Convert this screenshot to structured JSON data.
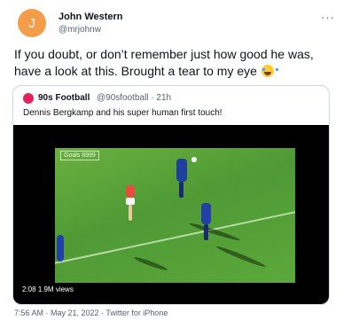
{
  "author": {
    "avatar_letter": "J",
    "name": "John Western",
    "handle": "@mrjohnw",
    "avatar_color": "#f39c4a"
  },
  "more_icon": "ellipsis-icon",
  "tweet": {
    "text": "If you doubt, or don’t remember just how good he was, have a look at this.   Brought a tear to my eye",
    "emoji": "face-with-tears-of-joy"
  },
  "quoted": {
    "name": "90s Football",
    "handle": "@90sfootball · 21h",
    "text": "Dennis Bergkamp and his super human first touch!",
    "video": {
      "watermark": "Goals 8999",
      "duration": "2:08",
      "views": "1.9M views"
    }
  },
  "footer": {
    "meta": "7:56 AM · May 21, 2022 · Twitter for iPhone"
  }
}
